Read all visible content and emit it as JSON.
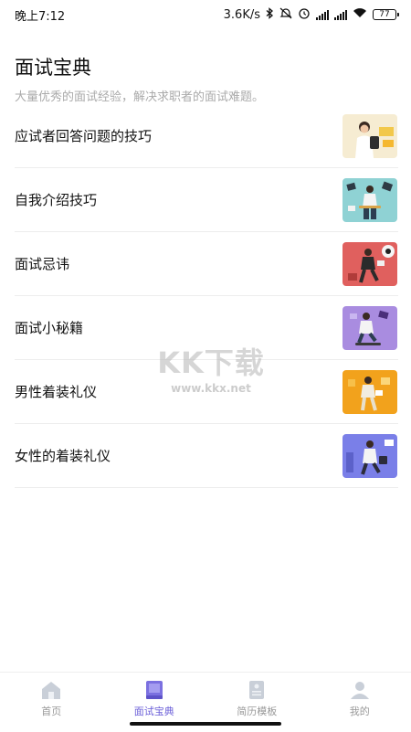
{
  "status_bar": {
    "time": "晚上7:12",
    "net_speed": "3.6K/s",
    "battery": "77",
    "icons": [
      "bluetooth-icon",
      "mute-icon",
      "alarm-icon",
      "signal-icon",
      "hd-signal-icon",
      "wifi-icon",
      "battery-icon"
    ]
  },
  "header": {
    "title": "面试宝典",
    "subtitle": "大量优秀的面试经验，解决求职者的面试难题。"
  },
  "list": {
    "items": [
      {
        "label": "应试者回答问题的技巧",
        "thumb_color": "#f3e7c8"
      },
      {
        "label": "自我介绍技巧",
        "thumb_color": "#8fd2d4"
      },
      {
        "label": "面试忌讳",
        "thumb_color": "#e0605e"
      },
      {
        "label": "面试小秘籍",
        "thumb_color": "#a98ce0"
      },
      {
        "label": "男性着装礼仪",
        "thumb_color": "#f2a21c"
      },
      {
        "label": "女性的着装礼仪",
        "thumb_color": "#7a7fe8"
      }
    ]
  },
  "watermark": {
    "logo": "KK下载",
    "url": "www.kkx.net"
  },
  "bottom_nav": {
    "active_color": "#6b5fd8",
    "items": [
      {
        "label": "首页",
        "icon": "home-icon"
      },
      {
        "label": "面试宝典",
        "icon": "book-icon"
      },
      {
        "label": "简历模板",
        "icon": "resume-icon"
      },
      {
        "label": "我的",
        "icon": "profile-icon"
      }
    ]
  }
}
